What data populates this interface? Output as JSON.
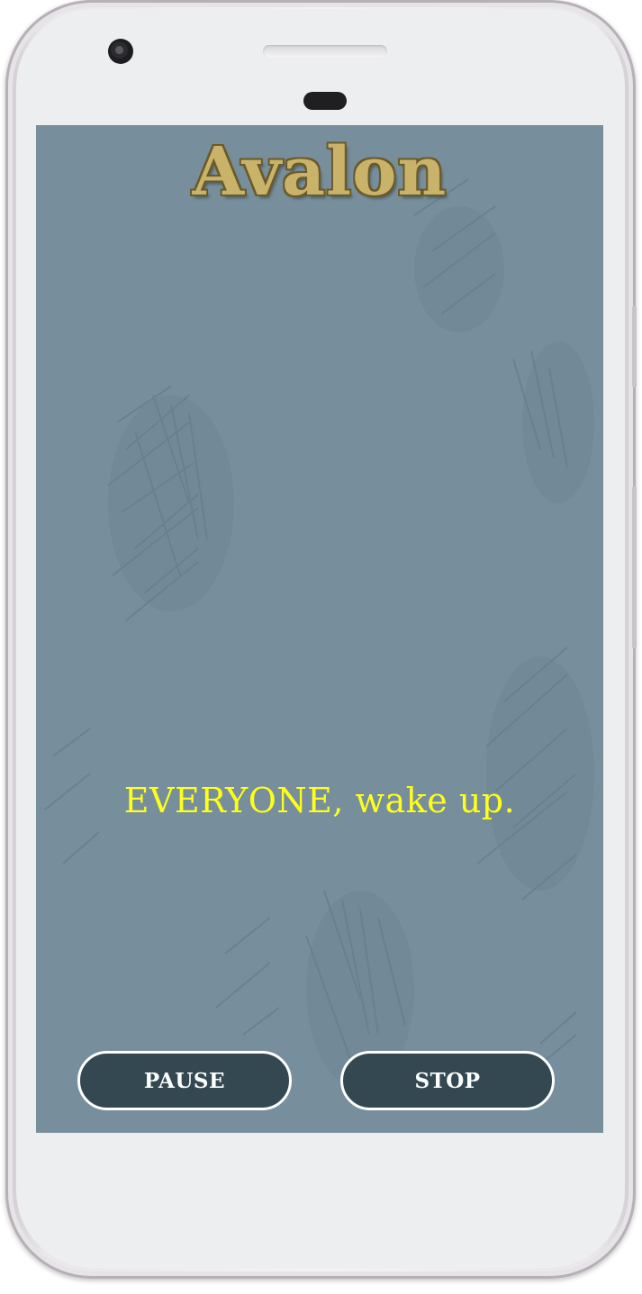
{
  "app": {
    "title": "Avalon"
  },
  "main": {
    "announcement": "EVERYONE, wake up."
  },
  "controls": {
    "pause_label": "PAUSE",
    "stop_label": "STOP"
  },
  "colors": {
    "screen_background": "#778f9c",
    "title_gold": "#c9b36b",
    "announcement_yellow": "#ffff1a",
    "button_fill": "#334851",
    "button_border": "#ffffff"
  }
}
